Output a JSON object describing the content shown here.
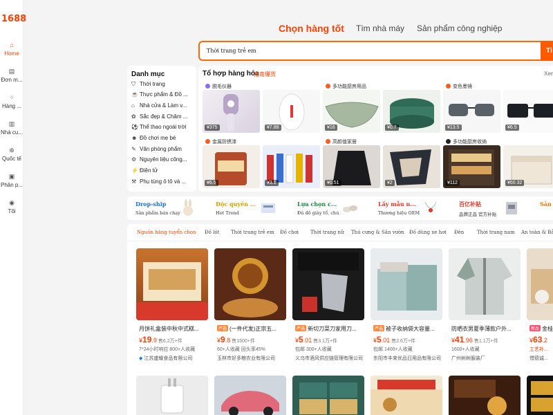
{
  "logo": "1688",
  "rail": [
    {
      "icon": "⌂",
      "label": "Home"
    },
    {
      "icon": "▤",
      "label": "Đơn m..."
    },
    {
      "icon": "⁘",
      "label": "Hàng ..."
    },
    {
      "icon": "▥",
      "label": "Nhà cu..."
    },
    {
      "icon": "⊕",
      "label": "Quốc tế"
    },
    {
      "icon": "▣",
      "label": "Phân p..."
    },
    {
      "icon": "◉",
      "label": "Tôi"
    }
  ],
  "tabs": [
    "Chọn hàng tốt",
    "Tìm nhà máy",
    "Sản phẩm công nghiệp"
  ],
  "search": {
    "value": "Thời trang trẻ em",
    "button": "Tì"
  },
  "categories": {
    "title": "Danh mục",
    "items": [
      {
        "icon": "⛉",
        "label": "Thời trang"
      },
      {
        "icon": "☕",
        "label": "Thực phẩm & Đồ ..."
      },
      {
        "icon": "⌂",
        "label": "Nhà cửa & Làm v..."
      },
      {
        "icon": "✿",
        "label": "Sắc đẹp & Chăm ..."
      },
      {
        "icon": "⚽",
        "label": "Thể thao ngoài trời"
      },
      {
        "icon": "☻",
        "label": "Đồ chơi mẹ bé"
      },
      {
        "icon": "✎",
        "label": "Văn phòng phẩm"
      },
      {
        "icon": "⚙",
        "label": "Nguyên liệu công..."
      },
      {
        "icon": "⚡",
        "label": "Điện tử"
      },
      {
        "icon": "⚒",
        "label": "Phụ tùng ô tô và ..."
      }
    ]
  },
  "combo": {
    "title": "Tổ hợp hàng hóa",
    "subtitle": "指南爆货",
    "more": "Xem",
    "groups": [
      {
        "label": "脱毛仪器",
        "dot": "#8e6cf0",
        "prices": [
          "¥375",
          "¥7.88"
        ]
      },
      {
        "label": "多功能厨房用品",
        "dot": "#ff5a1f",
        "prices": [
          "¥16",
          "¥0.7"
        ]
      },
      {
        "label": "变色墨镜",
        "dot": "#ff5a1f",
        "prices": [
          "¥13.5",
          "¥6.5"
        ]
      },
      {
        "label": "金属防锈漆",
        "dot": "#ff5a1f",
        "prices": [
          "¥6.5",
          "¥3.1"
        ]
      },
      {
        "label": "高颜值家居",
        "dot": "#ff5a1f",
        "prices": [
          "¥0.51",
          "¥2"
        ]
      },
      {
        "label": "多功能厨房收纳",
        "dot": "#222222",
        "prices": [
          "¥112",
          "¥60.32"
        ]
      }
    ]
  },
  "services": [
    {
      "title": "Drop-ship",
      "sub": "Sản phẩm bán chạy",
      "color": "#1b6fd8"
    },
    {
      "title": "Độc quyền ...",
      "sub": "Hot Trend",
      "color": "#d6a100"
    },
    {
      "title": "Lựa chọn c...",
      "sub": "Đủ đồ giày tổ, chú",
      "color": "#1b8a3c"
    },
    {
      "title": "Lấy mẫu n...",
      "sub": "Thương hiệu OEM",
      "color": "#e0382c"
    },
    {
      "title": "百亿补贴",
      "sub": "品牌正品 官方补贴",
      "color": "#e0382c"
    },
    {
      "title": "Sản p...",
      "sub": "",
      "color": "#e07b00"
    }
  ],
  "feed": {
    "tabs": [
      "Nguồn hàng tuyển chọn",
      "Đồ lót",
      "Thời trang trẻ em",
      "Đồ chơi",
      "Thời trang nữ",
      "Thú cưng & Sân vườn",
      "Đồ dùng xe hơi",
      "Đèn",
      "Thời trang nam",
      "An toàn & Bảo"
    ],
    "cards": [
      {
        "title": "月饼礼盒装中秋中式糕...",
        "badge": "",
        "price": "19",
        "dec": ".9",
        "sales": "售6.2万+件",
        "note": "7*24小时响应 800+人收藏",
        "shop": "江苏盛耀食品有限公司",
        "verified": true
      },
      {
        "title": "(一件代发)正宗五...",
        "badge": "严选",
        "price": "9",
        "dec": ".8",
        "sales": "售1500+件",
        "note": "60+人收藏 回头率45%",
        "shop": "玉林市好多粮农业有限公司",
        "verified": false
      },
      {
        "title": "新切刀菜刀家用刀...",
        "badge": "严选",
        "price": "5",
        "dec": ".01",
        "sales": "售3.1万+件",
        "note": "包邮 300+人收藏",
        "shop": "义乌市酒风供应链管理有限公司",
        "verified": false
      },
      {
        "title": "被子收纳袋大容量...",
        "badge": "严选",
        "price": "5",
        "dec": ".01",
        "sales": "售2.6万+件",
        "note": "包邮 1400+人收藏",
        "shop": "东阳市丰来优品日用品有限公司",
        "verified": false
      },
      {
        "title": "防晒衣男夏季薄款户外...",
        "badge": "",
        "price": "41",
        "dec": ".96",
        "sales": "售1.1万+件",
        "note": "1600+人收藏",
        "shop": "广州树树服装厂",
        "verified": false
      },
      {
        "title": "金桂...",
        "badge": "新品",
        "price": "63",
        "dec": ".2",
        "sales": "",
        "note": "工艺补...",
        "shop": "惜德诚...",
        "verified": false
      }
    ]
  }
}
